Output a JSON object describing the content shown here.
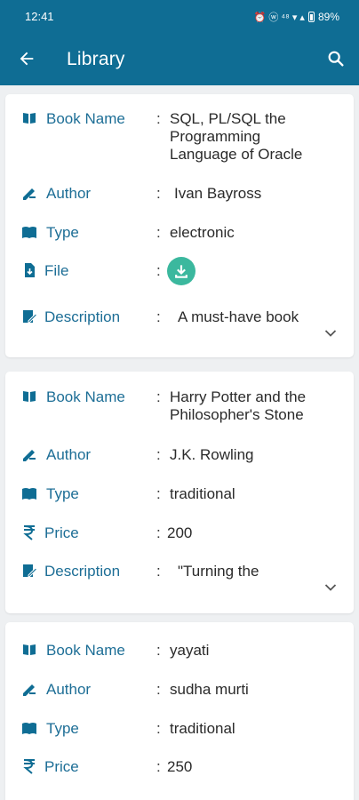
{
  "status": {
    "time": "12:41",
    "battery": "89%",
    "indicators": "⏰ ⓦ ⁴⁸ ▾ ▴"
  },
  "app_bar": {
    "title": "Library"
  },
  "icons": {
    "back": "arrow-left",
    "search": "magnifier",
    "download": "download-arrow",
    "expand": "chevron-down"
  },
  "colors": {
    "primary": "#0f6d94",
    "label": "#1d6e96",
    "download": "#3bb89e",
    "background": "#eef0f2"
  },
  "books": [
    {
      "name_label": "Book Name",
      "name": "SQL, PL/SQL the Programming Language of Oracle",
      "author_label": "Author",
      "author": "Ivan Bayross",
      "type_label": "Type",
      "type": "electronic",
      "file_label": "File",
      "desc_label": "Description",
      "description": "A must-have book"
    },
    {
      "name_label": "Book Name",
      "name": "Harry Potter and the Philosopher's Stone",
      "author_label": "Author",
      "author": "J.K. Rowling",
      "type_label": "Type",
      "type": "traditional",
      "price_label": "Price",
      "price": "200",
      "desc_label": "Description",
      "description": "\"Turning the"
    },
    {
      "name_label": "Book Name",
      "name": "yayati",
      "author_label": "Author",
      "author": "sudha murti",
      "type_label": "Type",
      "type": "traditional",
      "price_label": "Price",
      "price": "250"
    }
  ]
}
